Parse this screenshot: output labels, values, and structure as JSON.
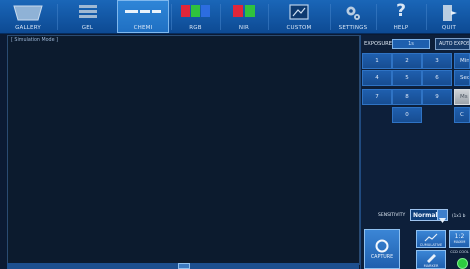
{
  "toolbar": {
    "gallery": "GALLERY",
    "gel": "GEL",
    "chemi": "CHEMI",
    "rgb": "RGB",
    "nir": "NIR",
    "custom": "CUSTOM",
    "settings": "SETTINGS",
    "help": "HELP",
    "quit": "QUIT"
  },
  "main": {
    "mode_label": "[ Simulation Mode ]"
  },
  "exposure": {
    "label": "EXPOSURE",
    "value": "1s",
    "auto_label": "AUTO EXPOSURE",
    "keys": [
      "1",
      "2",
      "3",
      "4",
      "5",
      "6",
      "7",
      "8",
      "9",
      "0"
    ],
    "side_keys": [
      "Min",
      "Sec",
      "Ms",
      "C"
    ]
  },
  "sensitivity": {
    "label": "SENSITIVITY",
    "value": "Normal",
    "suffix": "(1x1 b"
  },
  "buttons": {
    "capture": "CAPTURE",
    "cumulative": "CUMULATIVE",
    "marker": "MARKER",
    "ratio": "1:2",
    "maxim": "MAXIM",
    "ccd_cool": "CCD COOL"
  },
  "colors": {
    "toolbar": "#0d4a93",
    "panel": "#0c1b2e",
    "accent": "#1f5fae",
    "led": "#2ecc40"
  }
}
